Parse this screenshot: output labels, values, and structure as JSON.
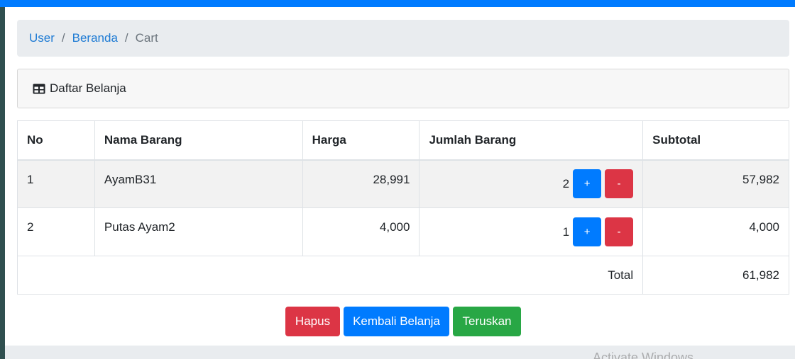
{
  "breadcrumb": {
    "items": [
      "User",
      "Beranda"
    ],
    "separator": "/",
    "active": "Cart"
  },
  "card": {
    "title": "Daftar Belanja",
    "icon": "table-icon"
  },
  "table": {
    "headers": [
      "No",
      "Nama Barang",
      "Harga",
      "Jumlah Barang",
      "Subtotal"
    ],
    "rows": [
      {
        "no": "1",
        "name": "AyamB31",
        "price": "28,991",
        "qty": "2",
        "subtotal": "57,982"
      },
      {
        "no": "2",
        "name": "Putas Ayam2",
        "price": "4,000",
        "qty": "1",
        "subtotal": "4,000"
      }
    ],
    "plus_label": "+",
    "minus_label": "-",
    "total_label": "Total",
    "total_value": "61,982"
  },
  "actions": {
    "delete_label": "Hapus",
    "back_label": "Kembali Belanja",
    "continue_label": "Teruskan"
  },
  "watermark": "Activate Windows",
  "colors": {
    "primary": "#007bff",
    "danger": "#dc3545",
    "success": "#28a745",
    "link": "#1e7bd4"
  }
}
